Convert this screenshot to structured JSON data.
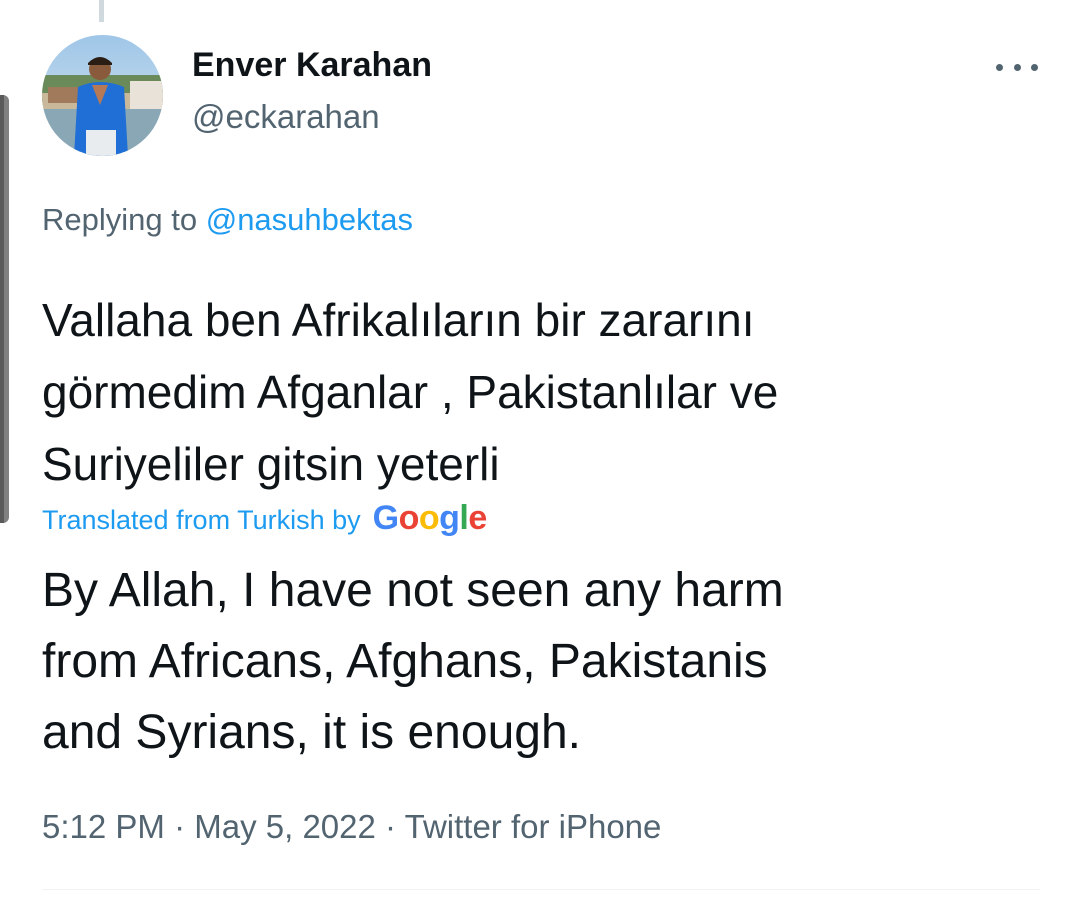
{
  "author": {
    "display_name": "Enver Karahan",
    "handle": "@eckarahan",
    "avatar_icon": "profile-photo"
  },
  "more_icon": "more-options-icon",
  "reply": {
    "prefix": "Replying to",
    "mention": "@nasuhbektas"
  },
  "tweet": {
    "lines": [
      "Vallaha ben Afrikalıların bir zararını",
      "görmedim Afganlar , Pakistanlılar ve",
      "Suriyeliler gitsin yeterli"
    ]
  },
  "translation": {
    "label": "Translated from Turkish by",
    "provider": "Google",
    "lines": [
      "By Allah, I have not seen any harm",
      "from Africans, Afghans, Pakistanis",
      "and Syrians, it is enough."
    ]
  },
  "meta": {
    "time": "5:12 PM",
    "date": "May 5, 2022",
    "source": "Twitter for iPhone"
  },
  "colors": {
    "link": "#1d9bf0",
    "secondary_text": "#536471",
    "primary_text": "#0f1419"
  }
}
